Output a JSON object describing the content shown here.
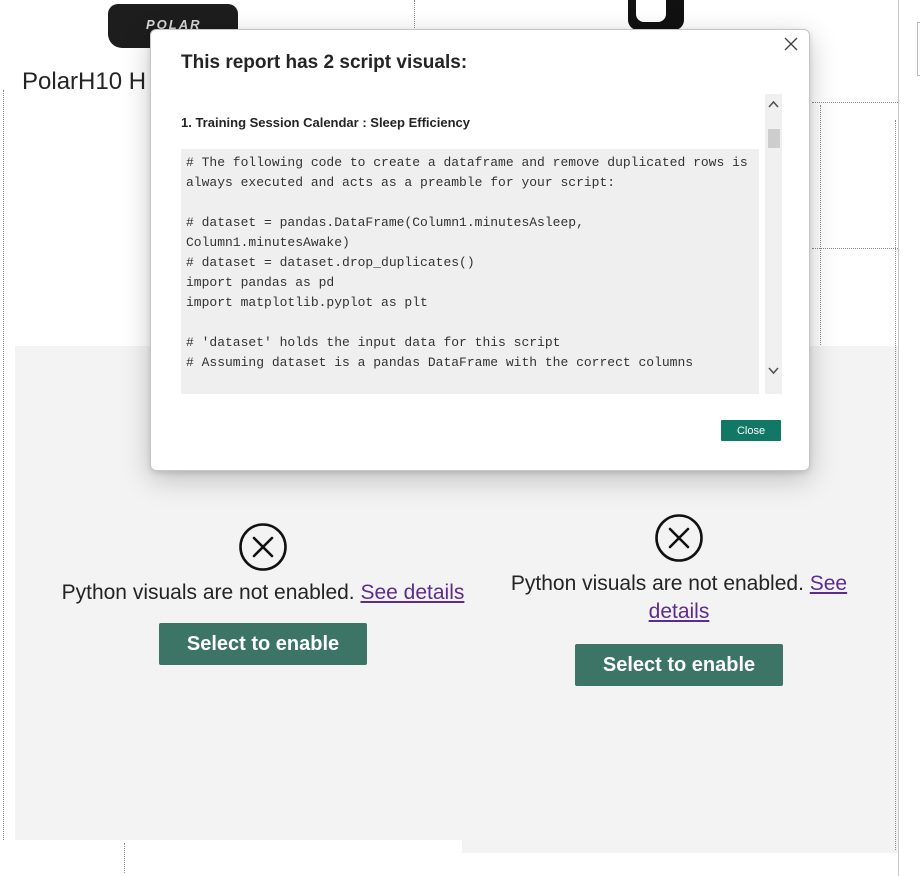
{
  "canvas": {
    "card_title": "PolarH10 H",
    "strap_logo": "POLAR"
  },
  "placeholders": [
    {
      "message": "Python visuals are not enabled.",
      "link": "See details",
      "button": "Select to enable"
    },
    {
      "message": "Python visuals are not enabled.",
      "link": "See details",
      "button": "Select to enable"
    }
  ],
  "dialog": {
    "title": "This report has 2 script visuals:",
    "section_heading": "1. Training Session Calendar : Sleep Efficiency",
    "code_lines": [
      "# The following code to create a dataframe and remove duplicated rows is",
      "always executed and acts as a preamble for your script:",
      "",
      "# dataset = pandas.DataFrame(Column1.minutesAsleep,",
      "Column1.minutesAwake)",
      "# dataset = dataset.drop_duplicates()",
      "import pandas as pd",
      "import matplotlib.pyplot as plt",
      "",
      "# 'dataset' holds the input data for this script",
      "# Assuming dataset is a pandas DataFrame with the correct columns",
      ""
    ],
    "close_label": "Close"
  },
  "colors": {
    "enable_button": "#3c7566",
    "close_button": "#117865",
    "link": "#5c2d91",
    "panel": "#f3f3f3"
  },
  "icons": {
    "dialog_close": "close-icon",
    "not_enabled": "circle-x-icon",
    "scroll_up": "chevron-up-icon",
    "scroll_down": "chevron-down-icon"
  }
}
